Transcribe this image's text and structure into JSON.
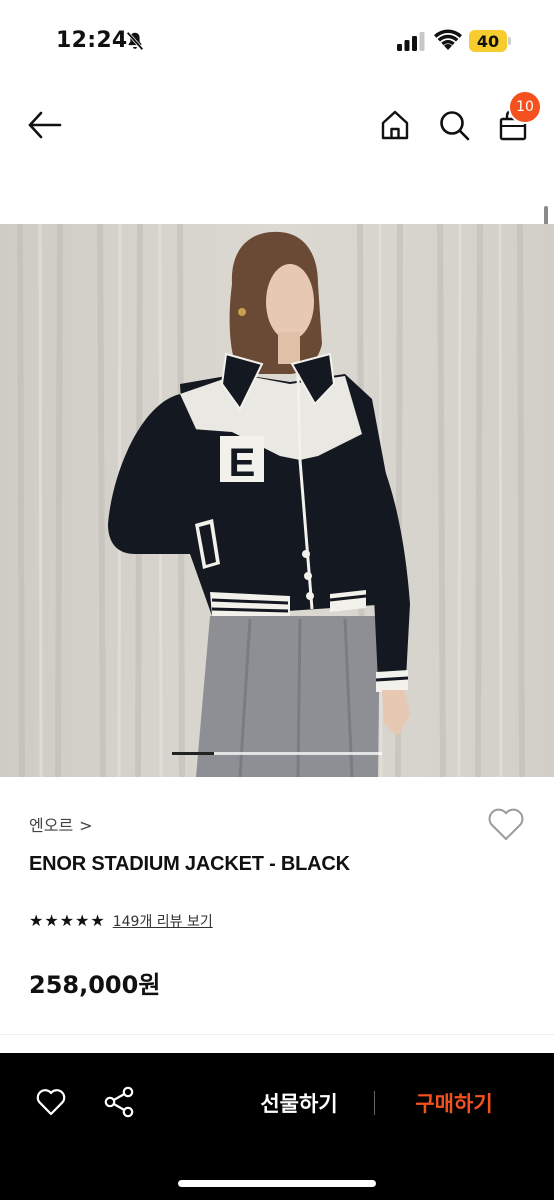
{
  "status_bar": {
    "time": "12:24",
    "battery": "40",
    "battery_color": "#f7cc2e",
    "icons": [
      "bell-slash-icon",
      "signal-icon",
      "wifi-icon"
    ]
  },
  "header": {
    "icons": [
      "back-arrow-icon",
      "home-icon",
      "search-icon",
      "shopping-bag-icon"
    ],
    "cart_count": "10",
    "badge_color": "#f4511e"
  },
  "gallery": {
    "image": "product-photo",
    "slide_position": 0.2
  },
  "product": {
    "brand": "엔오르",
    "brand_chevron": ">",
    "name": "ENOR STADIUM JACKET - BLACK",
    "rating_stars": 5,
    "review_link": "149개 리뷰 보기",
    "price": "258,000원"
  },
  "bottom_bar": {
    "gift_label": "선물하기",
    "buy_label": "구매하기",
    "buy_color": "#f4511e",
    "icons": [
      "heart-icon",
      "share-icon"
    ]
  }
}
